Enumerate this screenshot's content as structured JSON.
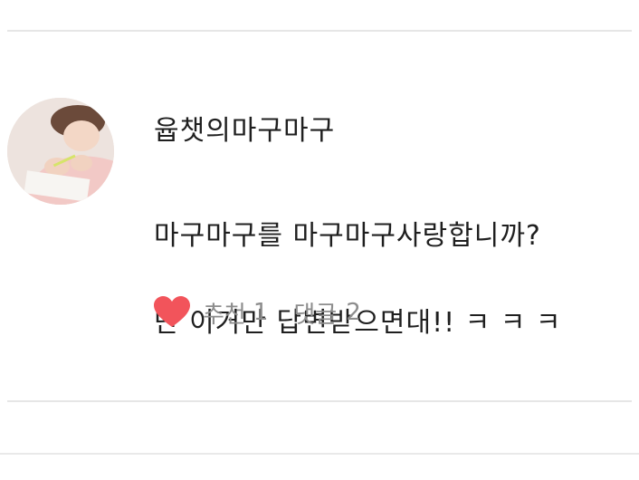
{
  "comment": {
    "author": "윱챗의마구마구",
    "text_line1": "마구마구를 마구마구사랑합니까?",
    "text_line2": "난 이거만 답변받으면대!! ㅋ ㅋ ㅋ",
    "likes_label": "추천",
    "likes_count": "1",
    "replies_label": "댓글",
    "replies_count": "2",
    "heart_color": "#f2545b"
  }
}
